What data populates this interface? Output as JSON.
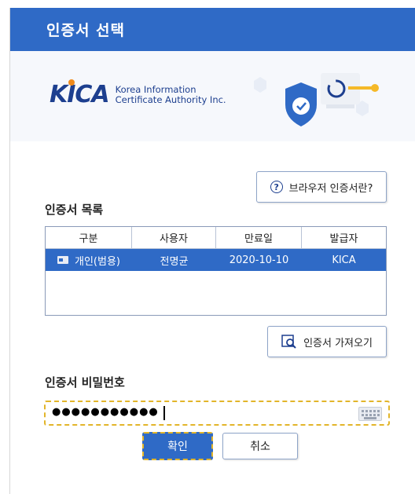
{
  "window": {
    "title": "인증서 선택"
  },
  "banner": {
    "logo_mark": "KICA",
    "company_line1": "Korea Information",
    "company_line2": "Certificate Authority Inc."
  },
  "help_button": {
    "label": "브라우저 인증서란?",
    "icon": "question-circle-icon"
  },
  "cert_list": {
    "label": "인증서 목록",
    "columns": [
      "구분",
      "사용자",
      "만료일",
      "발급자"
    ],
    "rows": [
      {
        "type": "개인(범용)",
        "user": "전명균",
        "expiry": "2020-10-10",
        "issuer": "KICA",
        "selected": true
      }
    ]
  },
  "import_button": {
    "label": "인증서 가져오기",
    "icon": "search-document-icon"
  },
  "password": {
    "label": "인증서 비밀번호",
    "masked_value": "●●●●●●●●●●●",
    "keyboard_icon": "virtual-keyboard-icon"
  },
  "actions": {
    "ok_label": "확인",
    "cancel_label": "취소"
  },
  "colors": {
    "accent": "#2f6ac6",
    "focus": "#e2b52a",
    "brand": "#1d3f8f",
    "brand_dot": "#f08a1b"
  }
}
